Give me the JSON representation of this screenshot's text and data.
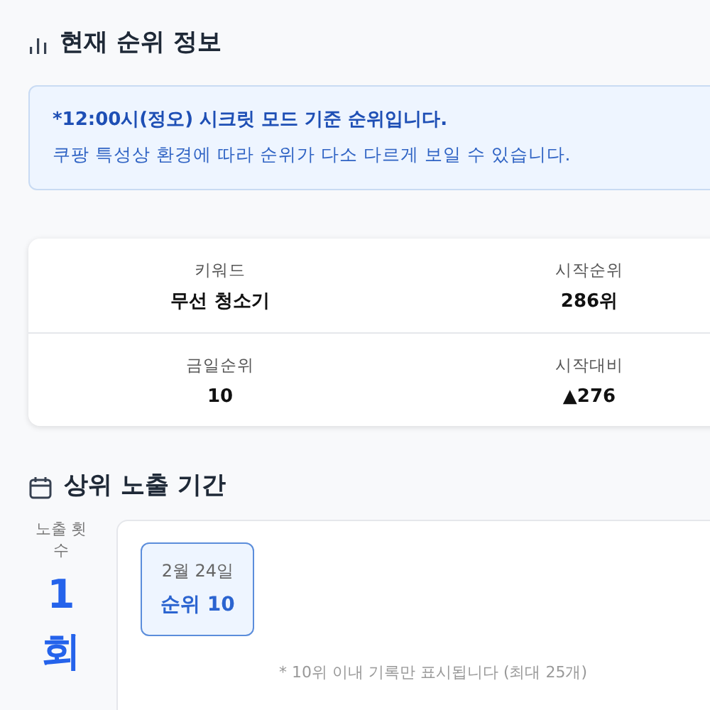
{
  "rank_section": {
    "title": "현재 순위 정보"
  },
  "notice": {
    "headline": "*12:00시(정오) 시크릿 모드 기준 순위입니다.",
    "detail": "쿠팡 특성상 환경에 따라 순위가 다소 다르게 보일 수 있습니다."
  },
  "stats": [
    {
      "label": "키워드",
      "value": "무선 청소기"
    },
    {
      "label": "시작순위",
      "value": "286위"
    },
    {
      "label": "금일순위",
      "value": "10"
    },
    {
      "label": "시작대비",
      "value": "▲276"
    }
  ],
  "exposure_section": {
    "title": "상위 노출 기간",
    "count_label": "노출 횟수",
    "count": "1회",
    "records": [
      {
        "date": "2월 24일",
        "rank": "순위 10"
      }
    ],
    "note": "* 10위 이내 기록만 표시됩니다 (최대 25개)"
  }
}
